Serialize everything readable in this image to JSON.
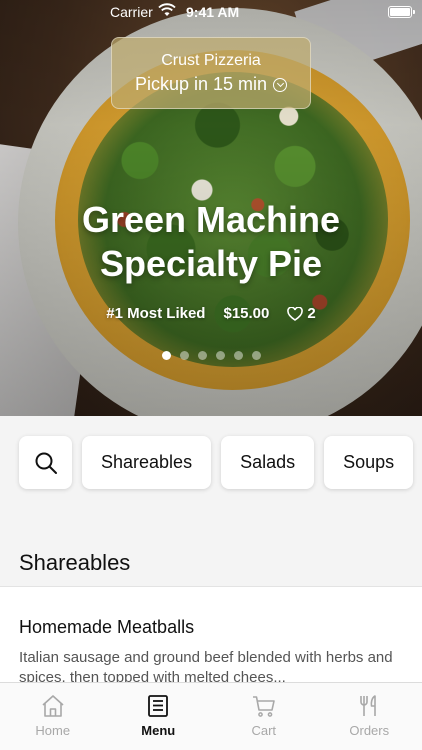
{
  "status_bar": {
    "carrier": "Carrier",
    "time": "9:41 AM"
  },
  "location": {
    "name": "Crust Pizzeria",
    "pickup": "Pickup in 15 min"
  },
  "hero": {
    "title_line1": "Green Machine",
    "title_line2": "Specialty Pie",
    "rank": "#1 Most Liked",
    "price": "$15.00",
    "likes": "2",
    "slide_count": 6,
    "active_slide": 1
  },
  "categories": {
    "search_icon": "search-icon",
    "items": [
      "Shareables",
      "Salads",
      "Soups"
    ]
  },
  "section": {
    "title": "Shareables"
  },
  "menu_item": {
    "name": "Homemade Meatballs",
    "description": "Italian sausage and ground beef blended with herbs and spices, then topped with melted chees..."
  },
  "tabbar": {
    "tabs": [
      {
        "label": "Home",
        "icon": "home-icon",
        "active": false
      },
      {
        "label": "Menu",
        "icon": "menu-icon",
        "active": true
      },
      {
        "label": "Cart",
        "icon": "cart-icon",
        "active": false
      },
      {
        "label": "Orders",
        "icon": "orders-icon",
        "active": false
      }
    ]
  },
  "colors": {
    "active_tab": "#111111",
    "inactive_tab": "#a8a8a8",
    "pill_bg": "#bea96e"
  }
}
